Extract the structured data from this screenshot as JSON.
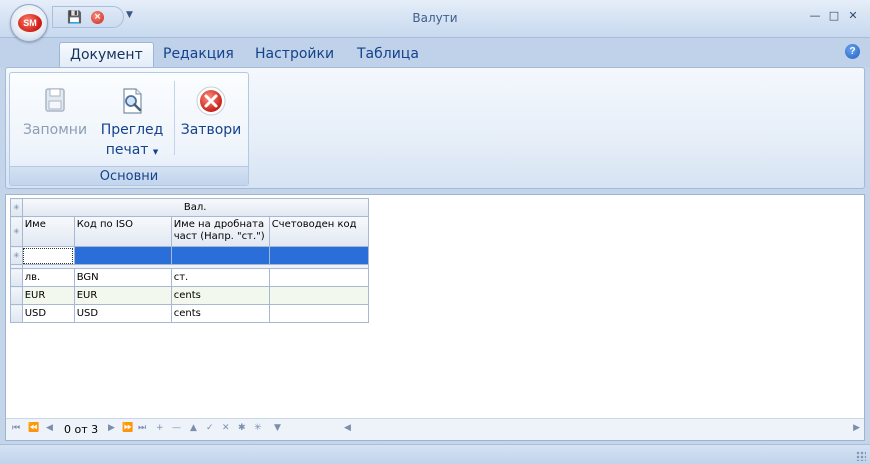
{
  "app": {
    "logo_text": "SM",
    "window_title": "Валути"
  },
  "tabs": [
    {
      "label": "Документ"
    },
    {
      "label": "Редакция"
    },
    {
      "label": "Настройки"
    },
    {
      "label": "Таблица"
    }
  ],
  "ribbon": {
    "group_label": "Основни",
    "buttons": {
      "save": "Запомни",
      "preview_line1": "Преглед",
      "preview_line2": "печат",
      "close": "Затвори"
    }
  },
  "grid": {
    "band_header": "Вал.",
    "columns": [
      "Име",
      "Код по ISO",
      "Име на дробната част (Напр. \"ст.\")",
      "Счетоводен код"
    ],
    "rows": [
      [
        "лв.",
        "BGN",
        "ст.",
        ""
      ],
      [
        "EUR",
        "EUR",
        "cents",
        ""
      ],
      [
        "USD",
        "USD",
        "cents",
        ""
      ]
    ]
  },
  "navigator": {
    "record_info": "0 от 3"
  },
  "colors": {
    "accent": "#15428b",
    "selection": "#2a6fd9"
  }
}
